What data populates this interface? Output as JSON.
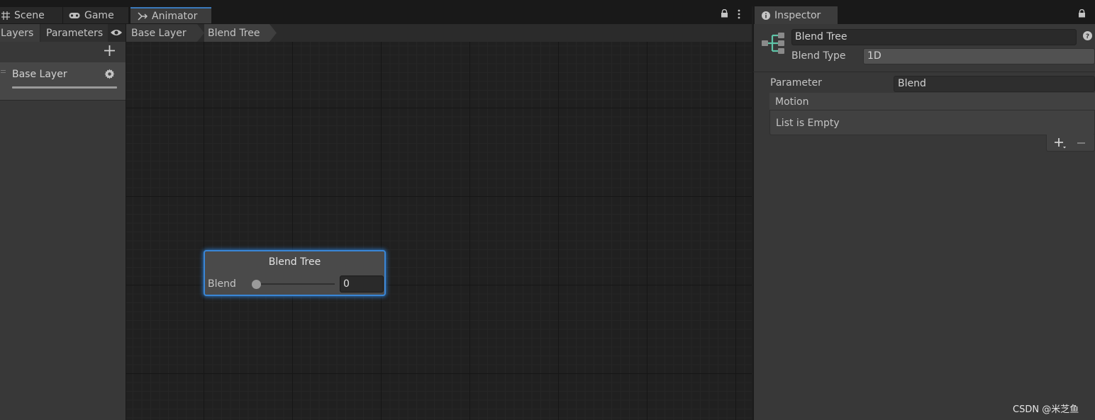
{
  "tabs": {
    "scene": "Scene",
    "game": "Game",
    "animator": "Animator",
    "inspector": "Inspector"
  },
  "animator": {
    "subtabs": {
      "layers": "Layers",
      "parameters": "Parameters"
    },
    "layer_name": "Base Layer",
    "breadcrumb": [
      "Base Layer",
      "Blend Tree"
    ],
    "node": {
      "title": "Blend Tree",
      "parameter_label": "Blend",
      "value": "0",
      "slider_fraction": 0
    }
  },
  "inspector": {
    "name_value": "Blend Tree",
    "blend_type_label": "Blend Type",
    "blend_type_value": "1D",
    "parameter_label": "Parameter",
    "parameter_value": "Blend",
    "motion_header": "Motion",
    "empty_text": "List is Empty"
  },
  "watermark": "CSDN @米芝鱼",
  "colors": {
    "accent": "#3a86d6",
    "blend_tree_icon": "#5fc4a8"
  },
  "icons": [
    "grid-icon",
    "gamepad-icon",
    "animator-icon",
    "lock-icon",
    "kebab-menu-icon",
    "plus-icon",
    "eye-icon",
    "gear-icon",
    "info-icon",
    "blend-tree-icon",
    "help-icon",
    "minus-icon",
    "drag-handle-icon"
  ]
}
